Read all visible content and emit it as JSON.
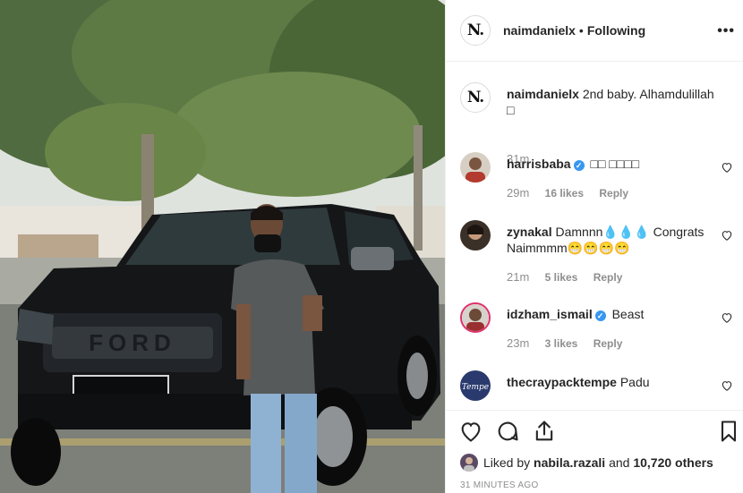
{
  "photo": {
    "plate_brand": "FORD"
  },
  "header": {
    "avatar_glyph": "N.",
    "username": "naimdanielx",
    "separator": "•",
    "following_label": "Following",
    "more_glyph": "•••"
  },
  "caption": {
    "username": "naimdanielx",
    "text": "2nd baby. Alhamdulillah",
    "second_line": "□",
    "time": "31m"
  },
  "comments": [
    {
      "username": "harrisbaba",
      "verified": true,
      "text": "□□ □□□□",
      "time": "29m",
      "likes": "16 likes",
      "reply": "Reply"
    },
    {
      "username": "zynakal",
      "verified": false,
      "text": "Damnnn💧💧💧 Congrats Naimmmm😁😁😁😁",
      "time": "21m",
      "likes": "5 likes",
      "reply": "Reply"
    },
    {
      "username": "idzham_ismail",
      "verified": true,
      "text": "Beast",
      "time": "23m",
      "likes": "3 likes",
      "reply": "Reply"
    },
    {
      "username": "thecraypacktempe",
      "verified": false,
      "text": "Padu",
      "time": "",
      "likes": "",
      "reply": ""
    }
  ],
  "actions": {
    "icons": [
      "heart-icon",
      "comment-icon",
      "share-icon",
      "bookmark-icon"
    ],
    "liked_by_prefix": "Liked by",
    "liked_by_user": "nabila.razali",
    "liked_by_suffix": "and",
    "liked_by_count": "10,720 others",
    "post_time": "31 MINUTES AGO"
  },
  "colors": {
    "accent_verified": "#3897f0",
    "secondary_text": "#8e8e8e",
    "border": "#efefef"
  }
}
